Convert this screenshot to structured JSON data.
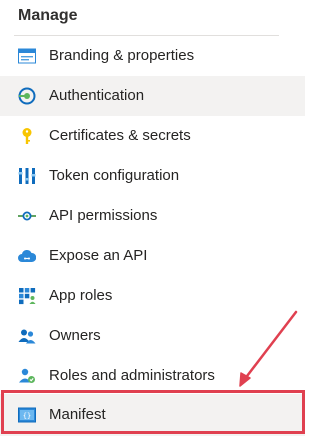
{
  "section": {
    "title": "Manage"
  },
  "nav_items": [
    {
      "label": "Branding & properties",
      "icon": "branding-icon"
    },
    {
      "label": "Authentication",
      "icon": "authentication-icon",
      "selected": true
    },
    {
      "label": "Certificates & secrets",
      "icon": "key-icon"
    },
    {
      "label": "Token configuration",
      "icon": "token-configuration-icon"
    },
    {
      "label": "API permissions",
      "icon": "api-permissions-icon"
    },
    {
      "label": "Expose an API",
      "icon": "cloud-icon"
    },
    {
      "label": "App roles",
      "icon": "app-roles-icon"
    },
    {
      "label": "Owners",
      "icon": "owners-icon"
    },
    {
      "label": "Roles and administrators",
      "icon": "roles-icon"
    },
    {
      "label": "Manifest",
      "icon": "manifest-icon",
      "highlighted": true
    }
  ],
  "annotation": {
    "highlight_color": "#e04050"
  }
}
